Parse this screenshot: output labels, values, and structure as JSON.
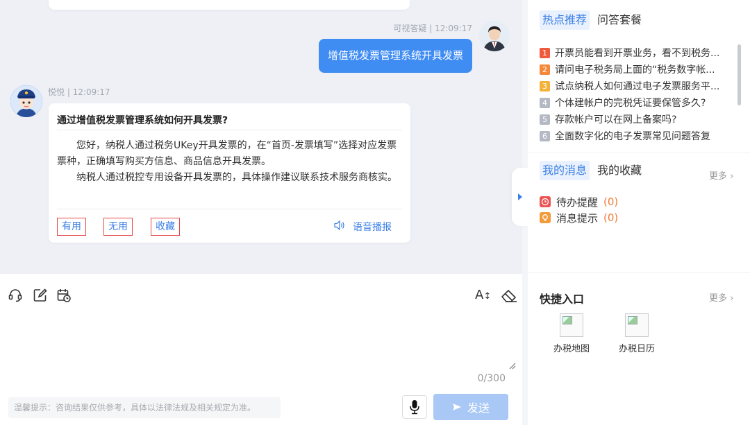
{
  "chat": {
    "user_meta": "可视答疑 | 12:09:17",
    "user_message": "增值税发票管理系统开具发票",
    "bot_meta": "悦悦 | 12:09:17",
    "bot_title": "通过增值税发票管理系统如何开具发票?",
    "bot_paragraph_1": "您好，纳税人通过税务UKey开具发票的，在“首页-发票填写”选择对应发票票种，正确填写购买方信息、商品信息开具发票。",
    "bot_paragraph_2": "纳税人通过税控专用设备开具发票的，具体操作建议联系技术服务商核实。",
    "feedback": {
      "useful": "有用",
      "useless": "无用",
      "favorite": "收藏"
    },
    "voice_label": "语音播报"
  },
  "input": {
    "counter": "0/300",
    "tip": "温馨提示：咨询结果仅供参考，具体以法律法规及相关规定为准。",
    "send_label": "发送",
    "font_tool_label": "A"
  },
  "sidebar": {
    "hot_tab": "热点推荐",
    "qa_tab": "问答套餐",
    "hot_items": [
      {
        "num": "1",
        "color": "#f05a3c",
        "text": "开票员能看到开票业务，看不到税务..."
      },
      {
        "num": "2",
        "color": "#f5883a",
        "text": "请问电子税务局上面的“税务数字帐..."
      },
      {
        "num": "3",
        "color": "#f5b23a",
        "text": "试点纳税人如何通过电子发票服务平..."
      },
      {
        "num": "4",
        "color": "#b4b9c4",
        "text": "个体建帐户的完税凭证要保管多久?"
      },
      {
        "num": "5",
        "color": "#b4b9c4",
        "text": "存款帐户可以在网上备案吗?"
      },
      {
        "num": "6",
        "color": "#b4b9c4",
        "text": "全面数字化的电子发票常见问题答复"
      }
    ],
    "msg_tab": "我的消息",
    "fav_tab": "我的收藏",
    "more": "更多 ›",
    "todo_label": "待办提醒",
    "todo_count": "(0)",
    "notice_label": "消息提示",
    "notice_count": "(0)",
    "quick_title": "快捷入口",
    "quick_more": "更多 ›",
    "quick_items": [
      "办税地图",
      "办税日历"
    ]
  }
}
